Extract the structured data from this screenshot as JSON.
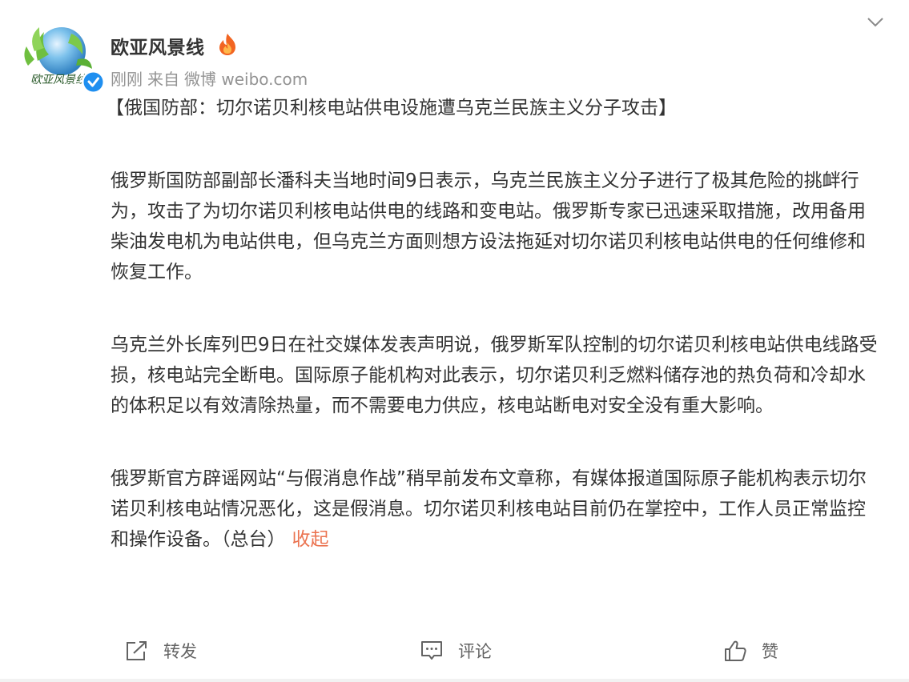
{
  "post": {
    "author": {
      "name": "欧亚风景线",
      "avatar_caption": "欧亚风景线",
      "badge": "verified-icon",
      "level_icon": "fire-icon"
    },
    "meta": {
      "time": "刚刚",
      "source_prefix": "来自",
      "source": "微博 weibo.com"
    },
    "headline": "【俄国防部：切尔诺贝利核电站供电设施遭乌克兰民族主义分子攻击】",
    "paragraphs": [
      "俄罗斯国防部副部长潘科夫当地时间9日表示，乌克兰民族主义分子进行了极其危险的挑衅行为，攻击了为切尔诺贝利核电站供电的线路和变电站。俄罗斯专家已迅速采取措施，改用备用柴油发电机为电站供电，但乌克兰方面则想方设法拖延对切尔诺贝利核电站供电的任何维修和恢复工作。",
      "乌克兰外长库列巴9日在社交媒体发表声明说，俄罗斯军队控制的切尔诺贝利核电站供电线路受损，核电站完全断电。国际原子能机构对此表示，切尔诺贝利乏燃料储存池的热负荷和冷却水的体积足以有效清除热量，而不需要电力供应，核电站断电对安全没有重大影响。",
      "俄罗斯官方辟谣网站“与假消息作战”稍早前发布文章称，有媒体报道国际原子能机构表示切尔诺贝利核电站情况恶化，这是假消息。切尔诺贝利核电站目前仍在掌控中，工作人员正常监控和操作设备。（总台）"
    ],
    "collapse_label": "收起"
  },
  "actions": {
    "repost": {
      "label": "转发",
      "icon": "share-icon"
    },
    "comment": {
      "label": "评论",
      "icon": "comment-icon"
    },
    "like": {
      "label": "赞",
      "icon": "thumbs-up-icon"
    }
  },
  "colors": {
    "text": "#333333",
    "meta": "#939393",
    "accent": "#eb7350",
    "verified": "#1f8ff0"
  }
}
